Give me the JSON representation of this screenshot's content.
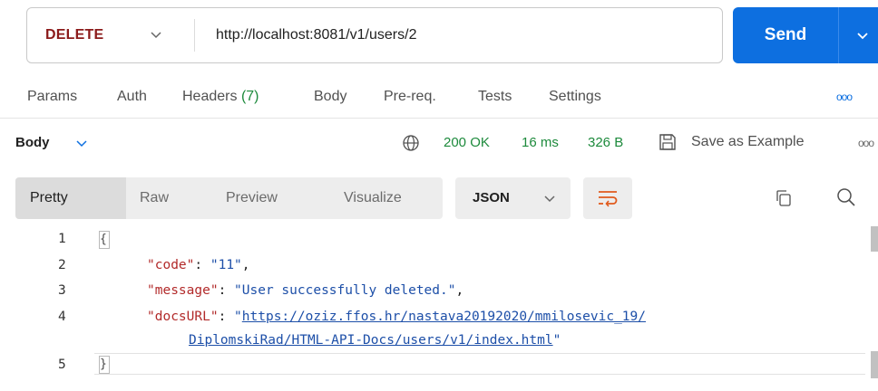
{
  "request": {
    "method": "DELETE",
    "url": "http://localhost:8081/v1/users/2",
    "send_label": "Send"
  },
  "colors": {
    "accent": "#0d6fe0",
    "method_delete": "#8b1a1a",
    "status_ok": "#1d8a3c"
  },
  "request_tabs": {
    "params": "Params",
    "auth": "Auth",
    "headers": "Headers",
    "headers_count": "(7)",
    "body": "Body",
    "prereq": "Pre-req.",
    "tests": "Tests",
    "settings": "Settings",
    "more": "ooo"
  },
  "response": {
    "title": "Body",
    "status": "200 OK",
    "time": "16 ms",
    "size": "326 B",
    "save_example": "Save as Example",
    "more": "ooo"
  },
  "view_modes": {
    "pretty": "Pretty",
    "raw": "Raw",
    "preview": "Preview",
    "visualize": "Visualize",
    "format": "JSON"
  },
  "code": {
    "line_numbers": [
      "1",
      "2",
      "3",
      "4",
      "5"
    ],
    "open_brace": "{",
    "close_brace": "}",
    "code_key": "\"code\"",
    "code_value": "\"11\"",
    "message_key": "\"message\"",
    "message_value": "\"User successfully deleted.\"",
    "docs_key": "\"docsURL\"",
    "docs_value_line1": "https://oziz.ffos.hr/nastava20192020/mmilosevic_19/",
    "docs_value_line2": "DiplomskiRad/HTML-API-Docs/users/v1/index.html"
  },
  "icons": [
    "chevron-down-icon",
    "globe-icon",
    "save-icon",
    "wrap-lines-icon",
    "copy-icon",
    "search-icon"
  ]
}
